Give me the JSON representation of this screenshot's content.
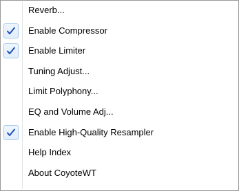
{
  "menu": {
    "items": [
      {
        "label": "Reverb...",
        "checked": false
      },
      {
        "label": "Enable Compressor",
        "checked": true
      },
      {
        "label": "Enable Limiter",
        "checked": true
      },
      {
        "label": "Tuning Adjust...",
        "checked": false
      },
      {
        "label": "Limit Polyphony...",
        "checked": false
      },
      {
        "label": "EQ and Volume Adj...",
        "checked": false
      },
      {
        "label": "Enable High-Quality Resampler",
        "checked": true
      },
      {
        "label": "Help Index",
        "checked": false
      },
      {
        "label": "About CoyoteWT",
        "checked": false
      }
    ],
    "check_icon": "checkmark-icon",
    "colors": {
      "border": "#979797",
      "check_box_border": "#a8c8ea",
      "check_mark": "#1c4fb8"
    }
  }
}
